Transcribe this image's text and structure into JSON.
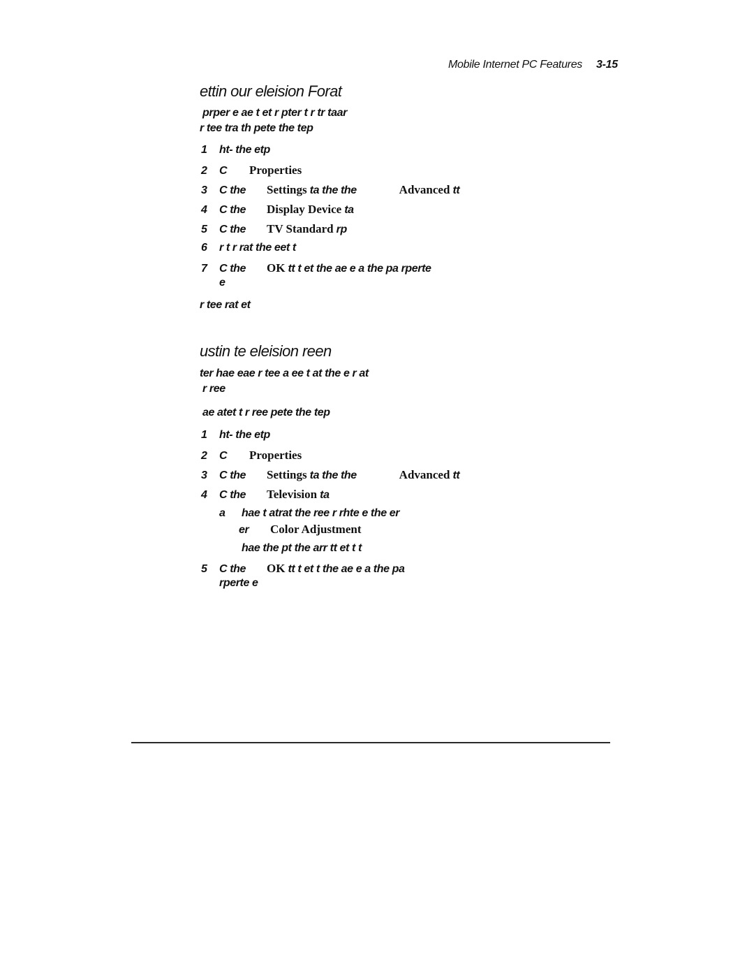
{
  "running_head": {
    "title": "Mobile Internet PC Features",
    "page_number": "3-15"
  },
  "section1": {
    "heading": "ettin  our eleision Forat",
    "intro_line1": "prper e ae  t et r pter t r tr taar",
    "intro_line2": "r tee tra   th pete the  tep",
    "steps": [
      {
        "num": "1",
        "pre": "ht- the  etp",
        "ui": "",
        "post": "",
        "ui2": "",
        "post2": ""
      },
      {
        "num": "2",
        "pre": "C",
        "ui": "Properties",
        "post": "",
        "ui2": "",
        "post2": ""
      },
      {
        "num": "3",
        "pre": "C the",
        "ui": "Settings",
        "post": "ta the  the",
        "ui2": "Advanced",
        "post2": "tt"
      },
      {
        "num": "4",
        "pre": "C the",
        "ui": "Display Device",
        "post": "ta",
        "ui2": "",
        "post2": ""
      },
      {
        "num": "5",
        "pre": "C the",
        "ui": "TV Standard",
        "post": "rp",
        "ui2": "",
        "post2": ""
      },
      {
        "num": "6",
        "pre": "r t  r  rat the eet t",
        "ui": "",
        "post": "",
        "ui2": "",
        "post2": ""
      },
      {
        "num": "7",
        "pre": "C the",
        "ui": "OK",
        "post": "tt t et the ae e a the pa rperte",
        "ui2": "",
        "post2": "",
        "cont": "e"
      }
    ],
    "footnote": "r tee rat   et"
  },
  "section2": {
    "heading": "ustin te eleision reen",
    "intro_line1": "ter  hae eae r tee  a ee t at the e r at",
    "intro_line2": "r ree",
    "intro2": "ae atet t r ree pete the  tep",
    "steps": [
      {
        "num": "1",
        "pre": "ht- the  etp",
        "ui": "",
        "post": "",
        "ui2": "",
        "post2": ""
      },
      {
        "num": "2",
        "pre": "C",
        "ui": "Properties",
        "post": "",
        "ui2": "",
        "post2": ""
      },
      {
        "num": "3",
        "pre": "C the",
        "ui": "Settings",
        "post": "ta the  the",
        "ui2": "Advanced",
        "post2": "tt"
      },
      {
        "num": "4",
        "pre": "C the",
        "ui": "Television",
        "post": "ta",
        "ui2": "",
        "post2": ""
      }
    ],
    "substep": {
      "label": "a",
      "line1": "hae t atrat  the ree r rhte e the er",
      "line2_pre": "er",
      "line2_ui": "Color Adjustment",
      "note": "hae the pt  the arr tt et t t"
    },
    "step5": {
      "num": "5",
      "pre": "C the",
      "ui": "OK",
      "post": "tt t et t  the ae e a the pa",
      "cont": "rperte e"
    }
  }
}
